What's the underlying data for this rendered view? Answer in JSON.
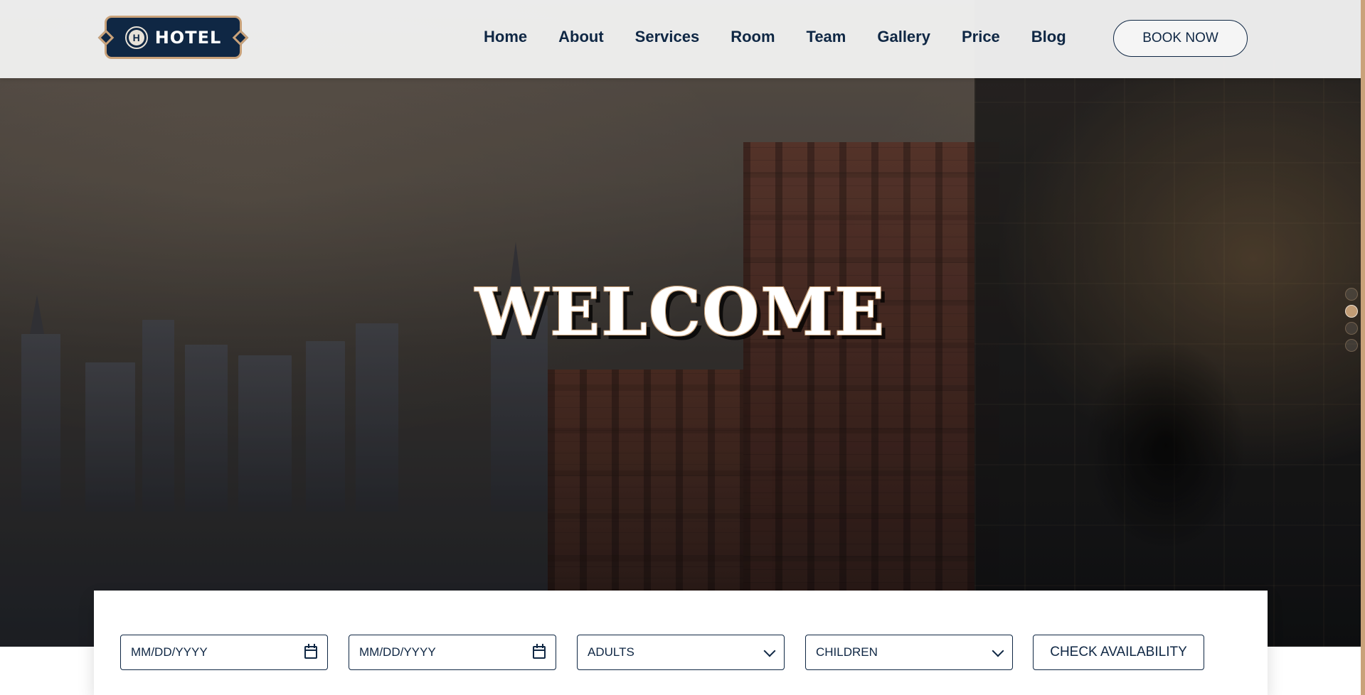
{
  "header": {
    "logo_text": "HOTEL",
    "logo_mark_text": "H",
    "nav": [
      "Home",
      "About",
      "Services",
      "Room",
      "Team",
      "Gallery",
      "Price",
      "Blog"
    ],
    "book_now": "BOOK NOW"
  },
  "hero": {
    "title": "WELCOME",
    "slider_dot_count": 4,
    "active_dot_index": 1
  },
  "booking": {
    "date_in": {
      "value": "MM/DD/YYYY"
    },
    "date_out": {
      "value": "MM/DD/YYYY"
    },
    "adults": {
      "value": "ADULTS"
    },
    "children": {
      "value": "CHILDREN"
    },
    "check_availability": "CHECK AVAILABILITY"
  },
  "colors": {
    "navy": "#0f2744",
    "gold": "#c9a27a",
    "header_bg": "#f1f1f1",
    "white": "#ffffff"
  },
  "icons": {
    "calendar": "calendar-icon",
    "chevron": "chevron-down-icon"
  }
}
